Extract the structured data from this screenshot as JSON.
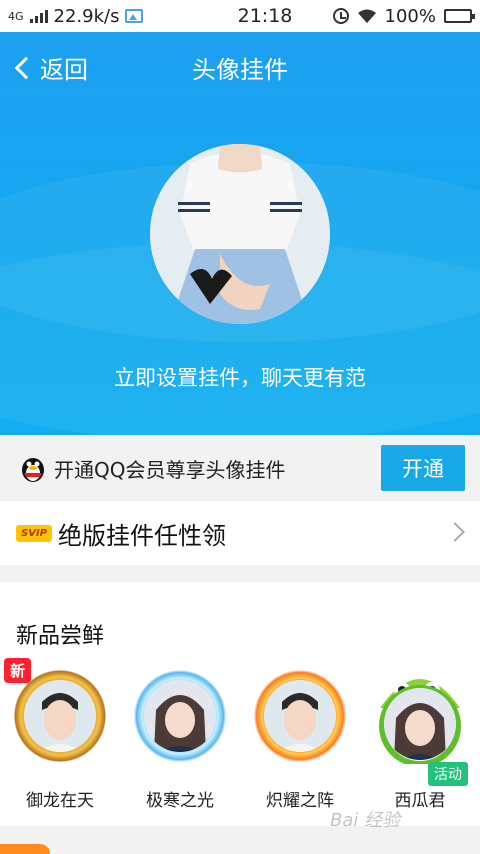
{
  "status_bar": {
    "network": "4G",
    "speed": "22.9k/s",
    "time": "21:18",
    "battery": "100%",
    "battery_level": 1.0
  },
  "header": {
    "back_label": "返回",
    "title": "头像挂件",
    "tagline": "立即设置挂件，聊天更有范"
  },
  "vip_bar": {
    "text": "开通QQ会员尊享头像挂件",
    "button_label": "开通"
  },
  "svip_row": {
    "badge": "SVIP",
    "text": "绝版挂件任性领"
  },
  "new_section": {
    "title": "新品尝鲜",
    "items": [
      {
        "label": "御龙在天",
        "tag": "新"
      },
      {
        "label": "极寒之光",
        "tag": ""
      },
      {
        "label": "炽耀之阵",
        "tag": ""
      },
      {
        "label": "西瓜君",
        "tag": "活动"
      }
    ]
  },
  "watermark": "Bai 经验",
  "colors": {
    "header_blue": "#1ea4ef",
    "button_blue": "#18a8e8",
    "new_red": "#ff1f30",
    "event_green": "#22c27e",
    "svip_gold": "#ffc400"
  }
}
